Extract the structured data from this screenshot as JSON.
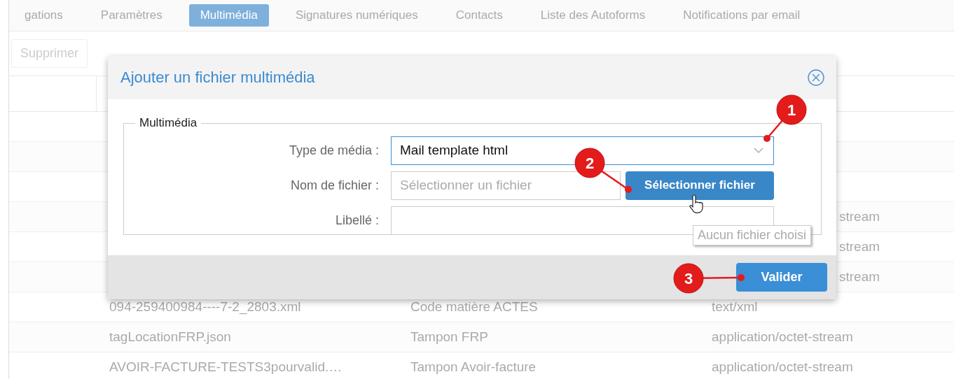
{
  "tabs": [
    {
      "label": "gations",
      "selected": false
    },
    {
      "label": "Paramètres",
      "selected": false
    },
    {
      "label": "Multimédia",
      "selected": true
    },
    {
      "label": "Signatures numériques",
      "selected": false
    },
    {
      "label": "Contacts",
      "selected": false
    },
    {
      "label": "Liste des Autoforms",
      "selected": false
    },
    {
      "label": "Notifications par email",
      "selected": false
    }
  ],
  "toolbar": {
    "delete_button": {
      "label": "Supprimer",
      "disabled": true
    }
  },
  "table": {
    "rows": [
      {},
      {},
      {},
      {
        "mime": "stream",
        "covered": true
      },
      {
        "mime": "stream",
        "covered": true
      },
      {
        "mime": "stream",
        "covered": true
      },
      {
        "file": "094-259400984----7-2_2803.xml",
        "label": "Code matière ACTES",
        "mime": "text/xml"
      },
      {
        "file": "tagLocationFRP.json",
        "label": "Tampon FRP",
        "mime": "application/octet-stream"
      },
      {
        "file": "AVOIR-FACTURE-TESTS3pourvalid.…",
        "label": "Tampon Avoir-facture",
        "mime": "application/octet-stream"
      }
    ]
  },
  "dialog": {
    "title": "Ajouter un fichier multimédia",
    "fieldset": "Multimédia",
    "fields": [
      {
        "kind": "select",
        "label": "Type de média :",
        "value": "Mail template html",
        "focused": true
      },
      {
        "kind": "file",
        "label": "Nom de fichier :",
        "placeholder": "Sélectionner un fichier",
        "button": "Sélectionner fichier"
      },
      {
        "kind": "text",
        "label": "Libellé :"
      }
    ],
    "tooltip": "Aucun fichier choisi",
    "submit": "Valider"
  },
  "callouts": [
    {
      "number": "1"
    },
    {
      "number": "2"
    },
    {
      "number": "3"
    }
  ]
}
